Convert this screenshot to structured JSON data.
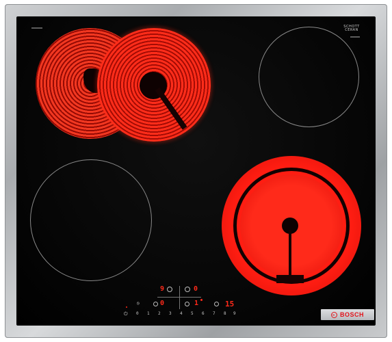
{
  "image": {
    "subject": "ceramic-cooktop",
    "colors": {
      "frame": "#b8bbbe",
      "glass": "#050505",
      "heat": "#ff2a1a",
      "brand": "#e3131b"
    }
  },
  "hob": {
    "schott_ceran": "SCHOTT CERAN",
    "zones": {
      "front_right_level": "15",
      "back_left_level": "9",
      "back_right_level": "0",
      "front_left_level": "0",
      "small_level": "1"
    },
    "slider_digits": [
      "0",
      "1",
      "2",
      "3",
      "4",
      "5",
      "6",
      "7",
      "8",
      "9"
    ]
  },
  "brand": {
    "name": "BOSCH"
  }
}
